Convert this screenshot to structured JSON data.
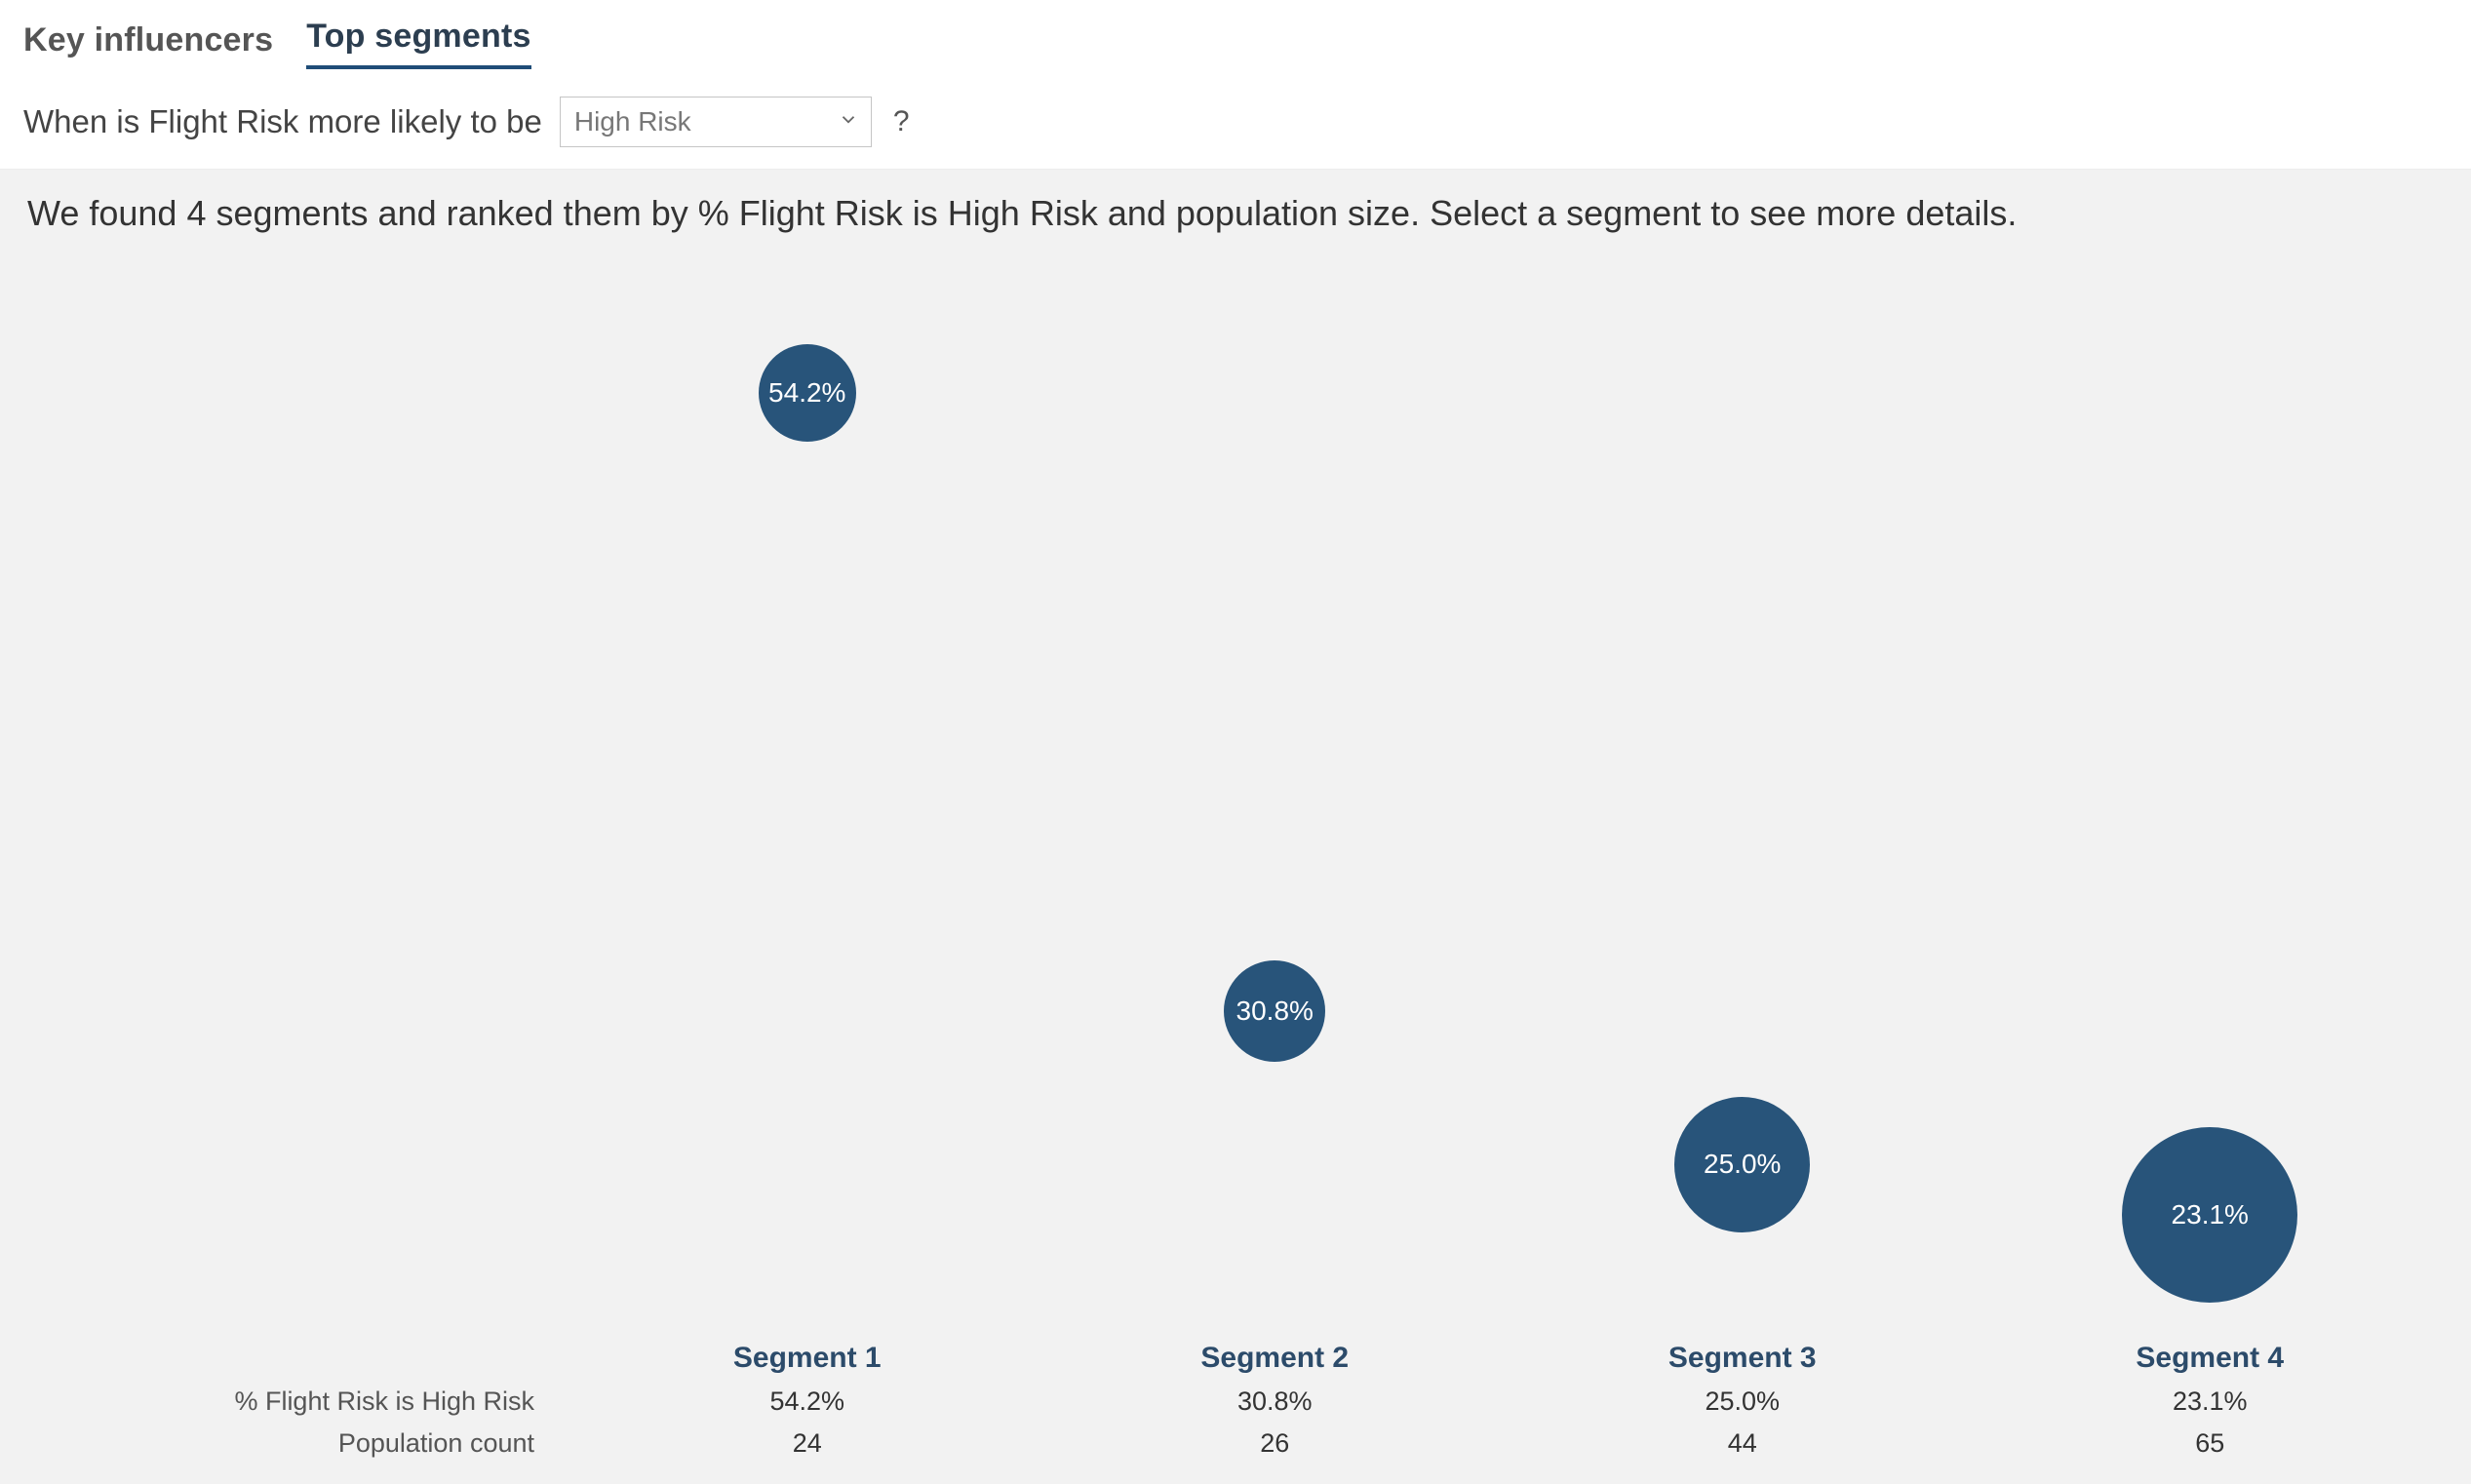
{
  "tabs": {
    "key_influencers": "Key influencers",
    "top_segments": "Top segments"
  },
  "filter": {
    "prefix": "When is Flight Risk more likely to be",
    "selected": "High Risk",
    "help": "?"
  },
  "summary": "We found 4 segments and ranked them by % Flight Risk is High Risk and population size. Select a segment to see more details.",
  "row_labels": {
    "pct": "% Flight Risk is High Risk",
    "pop": "Population count"
  },
  "segments": [
    {
      "name": "Segment 1",
      "pct_label": "54.2%",
      "pop_label": "24"
    },
    {
      "name": "Segment 2",
      "pct_label": "30.8%",
      "pop_label": "26"
    },
    {
      "name": "Segment 3",
      "pct_label": "25.0%",
      "pop_label": "44"
    },
    {
      "name": "Segment 4",
      "pct_label": "23.1%",
      "pop_label": "65"
    }
  ],
  "colors": {
    "bubble": "#28547a"
  },
  "chart_data": {
    "type": "scatter",
    "title": "",
    "xlabel": "Segment",
    "ylabel": "% Flight Risk is High Risk",
    "categories": [
      "Segment 1",
      "Segment 2",
      "Segment 3",
      "Segment 4"
    ],
    "series": [
      {
        "name": "% Flight Risk is High Risk",
        "values": [
          54.2,
          30.8,
          25.0,
          23.1
        ]
      },
      {
        "name": "Population count",
        "values": [
          24,
          26,
          44,
          65
        ]
      }
    ],
    "ylim": [
      0,
      60
    ],
    "size_encoding": "Population count",
    "y_encoding": "% Flight Risk is High Risk",
    "legend": false
  }
}
